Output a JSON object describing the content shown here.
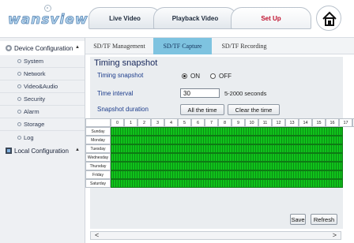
{
  "logo": {
    "text": "wansview",
    "icon": "camera-lens-icon"
  },
  "nav": {
    "tabs": [
      {
        "label": "Live Video"
      },
      {
        "label": "Playback Video"
      },
      {
        "label": "Set Up"
      }
    ],
    "home_icon": "house-icon",
    "active_color": "#c0102d"
  },
  "sidebar": {
    "device_config": "Device Configuration",
    "items": [
      "System",
      "Network",
      "Video&Audio",
      "Security",
      "Alarm",
      "Storage",
      "Log"
    ],
    "local_config": "Local Configuration"
  },
  "subtabs": [
    "SD/TF Management",
    "SD/TF Capture",
    "SD/TF Recording"
  ],
  "panel": {
    "title": "Timing snapshot",
    "snapshot_label": "Timing snapshot",
    "on": "ON",
    "off": "OFF",
    "selected": "ON",
    "interval_label": "Time interval",
    "interval_value": "30",
    "interval_hint": "5-2000 seconds",
    "duration_label": "Snapshot duration",
    "all_time": "All the time",
    "clear_time": "Clear the time"
  },
  "schedule": {
    "hours": [
      "0",
      "1",
      "2",
      "3",
      "4",
      "5",
      "6",
      "7",
      "8",
      "9",
      "10",
      "11",
      "12",
      "13",
      "14",
      "15",
      "16",
      "17",
      "18"
    ],
    "days": [
      "Sunday",
      "Monday",
      "Tuesday",
      "Wednesday",
      "Thursday",
      "Friday",
      "Saturday"
    ],
    "fill_color": "#10c21b"
  },
  "buttons": {
    "save": "Save",
    "refresh": "Refresh"
  },
  "scroll": {
    "left": "<",
    "right": ">"
  }
}
